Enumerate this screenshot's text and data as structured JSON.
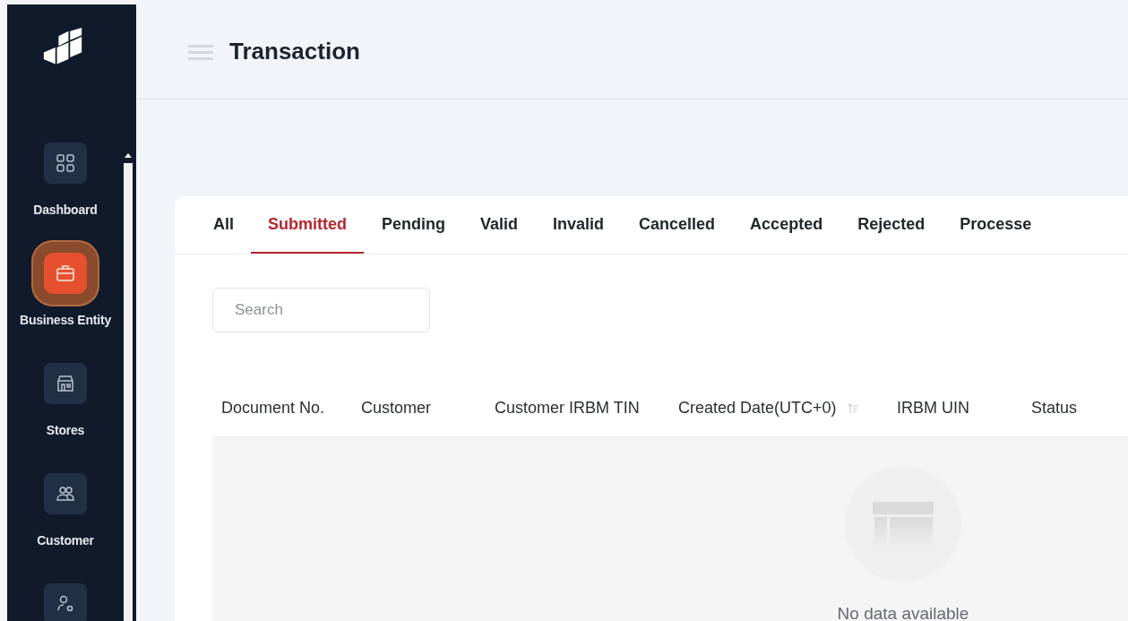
{
  "sidebar": {
    "items": [
      {
        "label": "Dashboard",
        "selected": false
      },
      {
        "label": "Business Entity",
        "selected": true
      },
      {
        "label": "Stores",
        "selected": false
      },
      {
        "label": "Customer",
        "selected": false
      },
      {
        "selected": false
      }
    ]
  },
  "header": {
    "title": "Transaction"
  },
  "tabs": [
    {
      "label": "All",
      "selected": false
    },
    {
      "label": "Submitted",
      "selected": true
    },
    {
      "label": "Pending",
      "selected": false
    },
    {
      "label": "Valid",
      "selected": false
    },
    {
      "label": "Invalid",
      "selected": false
    },
    {
      "label": "Cancelled",
      "selected": false
    },
    {
      "label": "Accepted",
      "selected": false
    },
    {
      "label": "Rejected",
      "selected": false
    },
    {
      "label": "Processe",
      "selected": false
    }
  ],
  "search": {
    "placeholder": "Search"
  },
  "table": {
    "columns": [
      {
        "label": "Document No."
      },
      {
        "label": "Customer"
      },
      {
        "label": "Customer IRBM TIN"
      },
      {
        "label": "Created Date(UTC+0)",
        "sortable": true
      },
      {
        "label": "IRBM UIN"
      },
      {
        "label": "Status"
      }
    ],
    "empty_text": "No data available"
  }
}
